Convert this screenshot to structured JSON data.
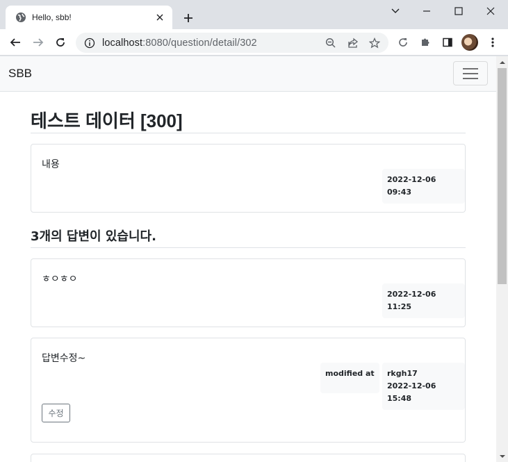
{
  "browser": {
    "tab_title": "Hello, sbb!",
    "url_host": "localhost",
    "url_rest": ":8080/question/detail/302"
  },
  "navbar": {
    "brand": "SBB"
  },
  "question": {
    "subject": "테스트 데이터 [300]",
    "content": "내용",
    "created": "2022-12-06 09:43"
  },
  "answers_header": "3개의 답변이 있습니다.",
  "answers": [
    {
      "content": "ㅎㅇㅎㅇ",
      "created": "2022-12-06 11:25"
    },
    {
      "content": "답변수정~",
      "modified_label": "modified at",
      "author": "rkgh17",
      "created": "2022-12-06 15:48",
      "edit_label": "수정"
    }
  ],
  "colors": {
    "chrome_bg": "#dee1e6",
    "navbar_bg": "#f8f9fa",
    "card_border": "#dfe2e5",
    "badge_bg": "#f8f9fa"
  }
}
